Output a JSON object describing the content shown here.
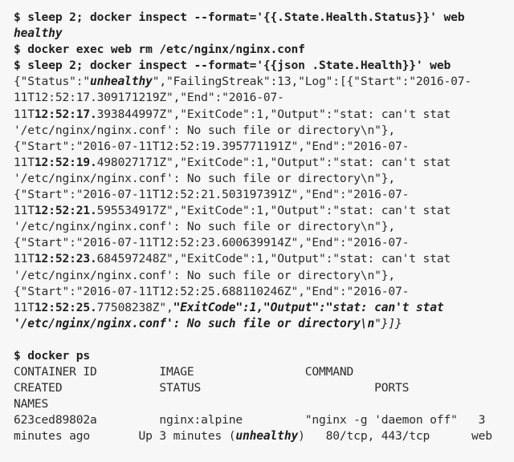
{
  "terminal": {
    "prompt": "$",
    "commands": {
      "c1": "sleep 2; docker inspect --format='{{.State.Health.Status}}' web",
      "c2": "docker exec web rm /etc/nginx/nginx.conf",
      "c3": "sleep 2; docker inspect --format='{{json .State.Health}}' web",
      "c4": "docker ps"
    },
    "outputs": {
      "health_status": "healthy",
      "json_prefix": "{\"Status\":\"",
      "json_status": "unhealthy",
      "json_after_status": "\",\"FailingStreak\":13,\"Log\":[{\"Start\":\"2016-07-",
      "l2a": "11T12:52:17.309171219Z\",\"End\":\"2016-07-",
      "l3a": "11T",
      "l3b": "12:52:17.",
      "l3c": "393844997Z\",\"ExitCode\":1,\"Output\":\"stat: can't stat",
      "l4": "'/etc/nginx/nginx.conf': No such file or directory\\n\"},",
      "l5": "{\"Start\":\"2016-07-11T12:52:19.395771191Z\",\"End\":\"2016-07-",
      "l6a": "11T",
      "l6b": "12:52:19.",
      "l6c": "498027171Z\",\"ExitCode\":1,\"Output\":\"stat: can't stat",
      "l7": "'/etc/nginx/nginx.conf': No such file or directory\\n\"},",
      "l8": "{\"Start\":\"2016-07-11T12:52:21.503197391Z\",\"End\":\"2016-07-",
      "l9a": "11T",
      "l9b": "12:52:21.",
      "l9c": "595534917Z\",\"ExitCode\":1,\"Output\":\"stat: can't stat",
      "l10": "'/etc/nginx/nginx.conf': No such file or directory\\n\"},",
      "l11": "{\"Start\":\"2016-07-11T12:52:23.600639914Z\",\"End\":\"2016-07-",
      "l12a": "11T",
      "l12b": "12:52:23.",
      "l12c": "684597248Z\",\"ExitCode\":1,\"Output\":\"stat: can't stat",
      "l13": "'/etc/nginx/nginx.conf': No such file or directory\\n\"},",
      "l14": "{\"Start\":\"2016-07-11T12:52:25.688110246Z\",\"End\":\"2016-07-",
      "l15a": "11T",
      "l15b": "12:52:25.",
      "l15c": "77508238Z\",",
      "l15d": "\"ExitCode\":1,\"Output\":\"stat: can't stat",
      "l16a": "'/etc/nginx/nginx.conf': No such file or directory\\n",
      "l16b": "\"}]}"
    },
    "docker_ps": {
      "header1": "CONTAINER ID         IMAGE                COMMAND",
      "header2": "CREATED              STATUS                         PORTS",
      "header3": "NAMES",
      "row1": "623ced89802a         nginx:alpine         \"nginx -g 'daemon off\"   3",
      "row2_a": "minutes ago       Up 3 minutes (",
      "row2_status": "unhealthy",
      "row2_b": ")   80/tcp, 443/tcp      web"
    }
  }
}
